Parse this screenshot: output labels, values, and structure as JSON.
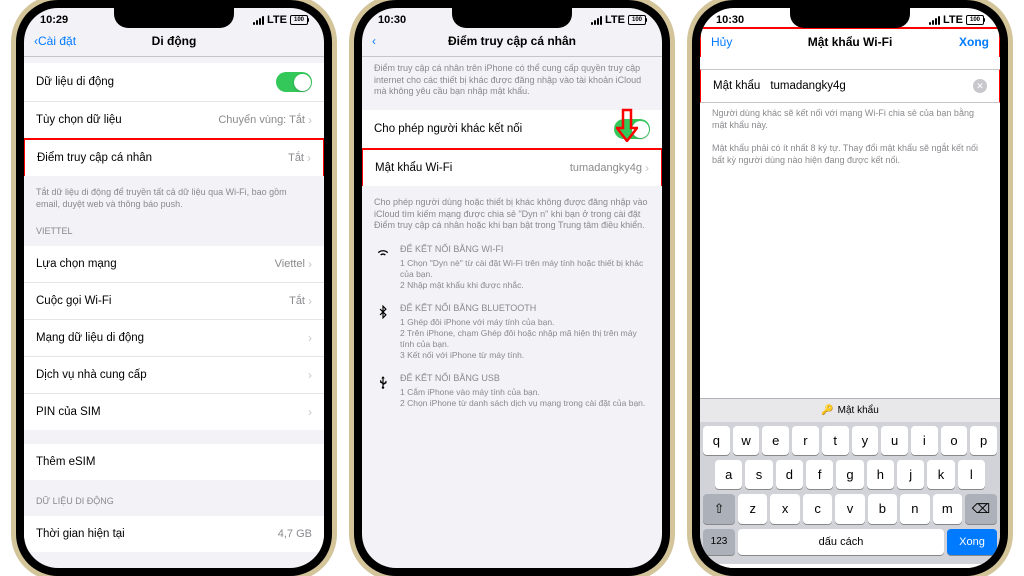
{
  "status": {
    "t1": "10:29",
    "t2": "10:30",
    "t3": "10:30",
    "lte": "LTE",
    "bat": "100"
  },
  "p1": {
    "back": "Cài đặt",
    "title": "Di động",
    "rows": [
      {
        "label": "Dữ liệu di động",
        "type": "toggle"
      },
      {
        "label": "Tùy chọn dữ liệu",
        "val": "Chuyển vùng: Tắt"
      },
      {
        "label": "Điểm truy cập cá nhân",
        "val": "Tắt",
        "hl": true
      }
    ],
    "foot1": "Tắt dữ liệu di động để truyền tất cả dữ liệu qua Wi-Fi, bao gồm email, duyệt web và thông báo push.",
    "sec2": "VIETTEL",
    "rows2": [
      {
        "label": "Lựa chọn mạng",
        "val": "Viettel"
      },
      {
        "label": "Cuộc gọi Wi-Fi",
        "val": "Tắt"
      },
      {
        "label": "Mạng dữ liệu di động"
      },
      {
        "label": "Dịch vụ nhà cung cấp"
      },
      {
        "label": "PIN của SIM"
      }
    ],
    "esim": "Thêm eSIM",
    "sec3": "DỮ LIỆU DI ĐỘNG",
    "row3": {
      "label": "Thời gian hiện tại",
      "val": "4,7 GB"
    }
  },
  "p2": {
    "title": "Điểm truy cập cá nhân",
    "desc": "Điểm truy cập cá nhân trên iPhone có thể cung cấp quyền truy cập internet cho các thiết bị khác được đăng nhập vào tài khoản iCloud mà không yêu cầu bạn nhập mật khẩu.",
    "r1": "Cho phép người khác kết nối",
    "r2": {
      "label": "Mật khẩu Wi-Fi",
      "val": "tumadangky4g"
    },
    "foot": "Cho phép người dùng hoặc thiết bị khác không được đăng nhập vào iCloud tìm kiếm mạng được chia sẻ \"Dyn n\" khi bạn ở trong cài đặt Điểm truy cập cá nhân hoặc khi bạn bật trong Trung tâm điều khiển.",
    "wifi": {
      "h": "ĐỂ KẾT NỐI BẰNG WI-FI",
      "l1": "1 Chọn \"Dyn nè\" từ cài đặt Wi-Fi trên máy tính hoặc thiết bị khác của bạn.",
      "l2": "2 Nhập mật khẩu khi được nhắc."
    },
    "bt": {
      "h": "ĐỂ KẾT NỐI BẰNG BLUETOOTH",
      "l1": "1 Ghép đôi iPhone với máy tính của bạn.",
      "l2": "2 Trên iPhone, chạm Ghép đôi hoặc nhập mã hiện thị trên máy tính của bạn.",
      "l3": "3 Kết nối với iPhone từ máy tính."
    },
    "usb": {
      "h": "ĐỂ KẾT NỐI BẰNG USB",
      "l1": "1 Cắm iPhone vào máy tính của bạn.",
      "l2": "2 Chọn iPhone từ danh sách dịch vụ mạng trong cài đặt của bạn."
    }
  },
  "p3": {
    "cancel": "Hủy",
    "title": "Mật khẩu Wi-Fi",
    "done": "Xong",
    "field": {
      "label": "Mật khẩu",
      "val": "tumadangky4g"
    },
    "f1": "Người dùng khác sẽ kết nối với mạng Wi-Fi chia sẻ của bạn bằng mật khẩu này.",
    "f2": "Mật khẩu phải có ít nhất 8 ký tự. Thay đổi mật khẩu sẽ ngắt kết nối bất kỳ người dùng nào hiện đang được kết nối.",
    "hint": "Mật khẩu",
    "kb": {
      "space": "dấu cách",
      "done": "Xong",
      "num": "123"
    }
  }
}
